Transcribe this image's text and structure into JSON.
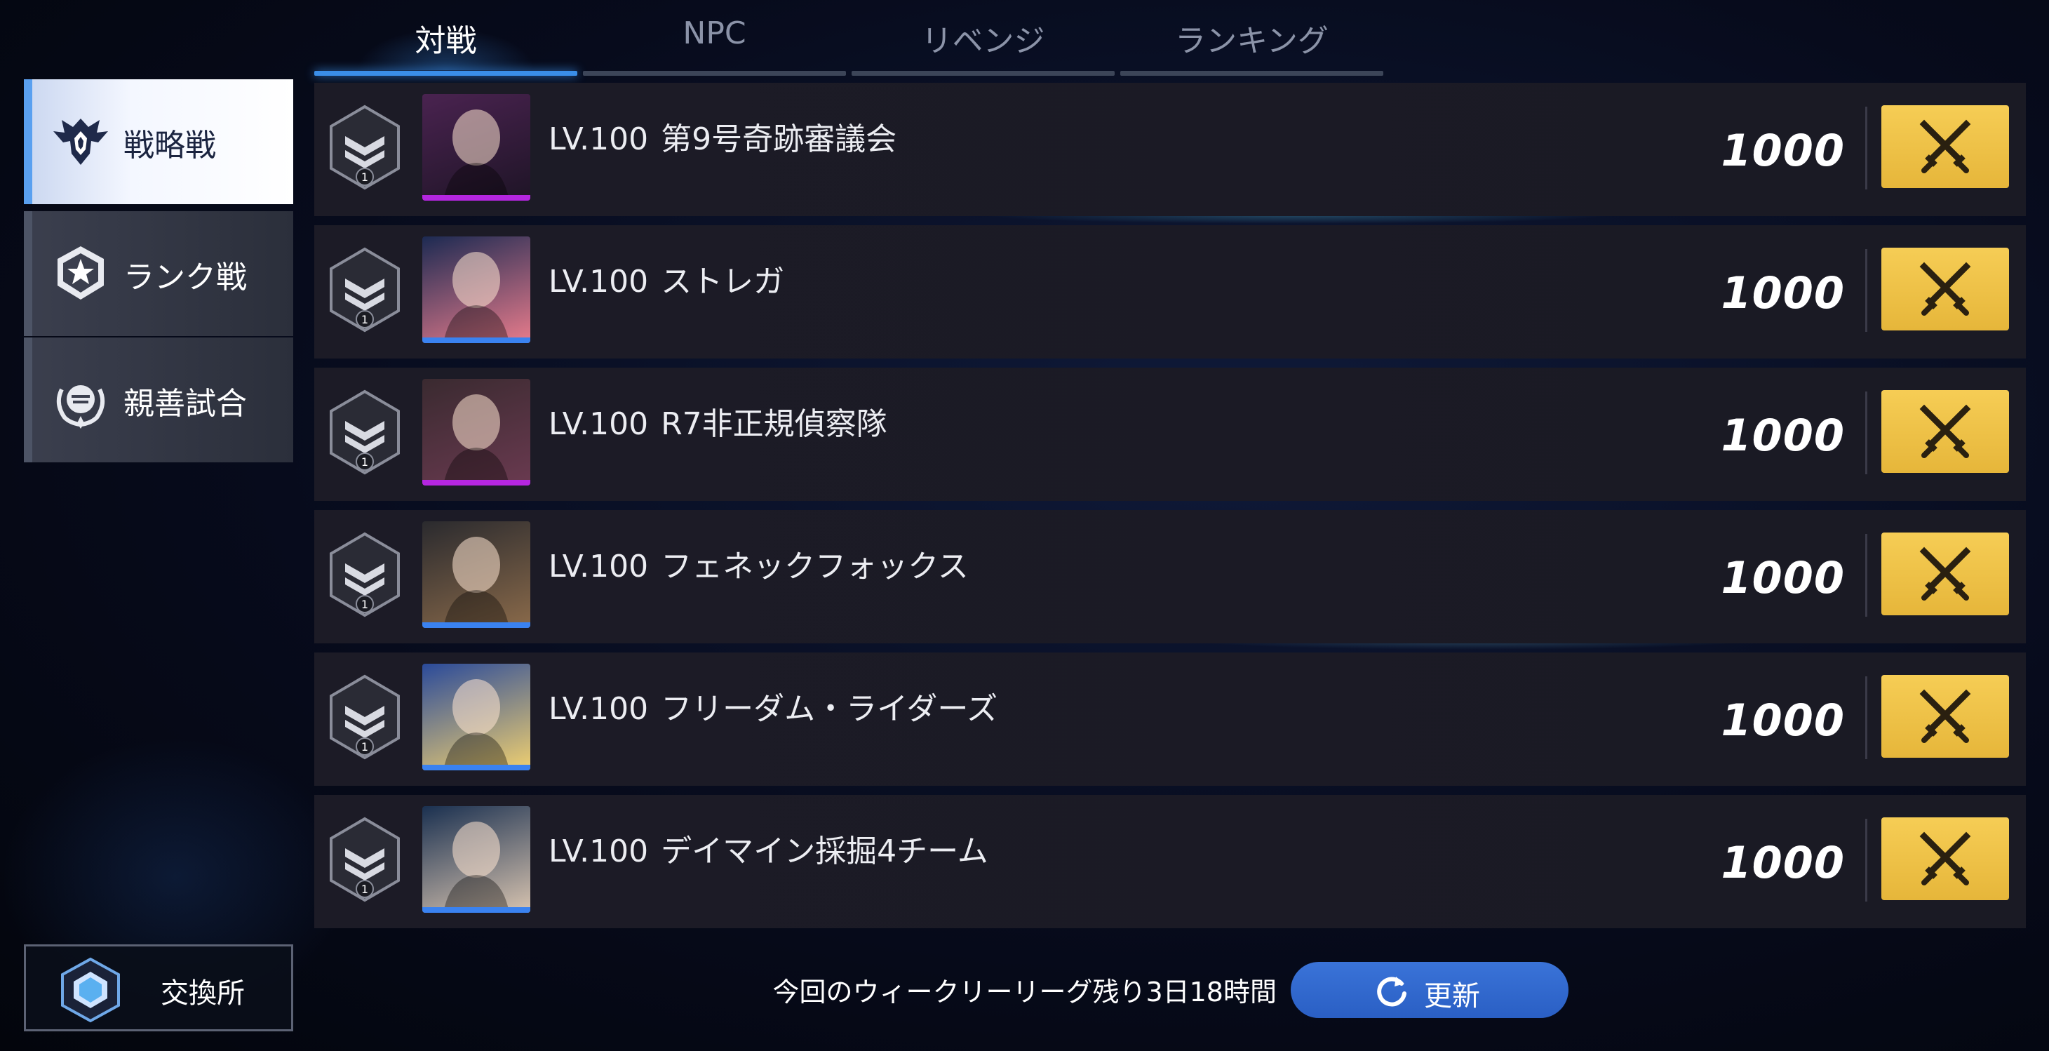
{
  "tabs": [
    {
      "label": "対戦",
      "active": true
    },
    {
      "label": "NPC",
      "active": false
    },
    {
      "label": "リベンジ",
      "active": false
    },
    {
      "label": "ランキング",
      "active": false
    }
  ],
  "side_menu": [
    {
      "label": "戦略戦",
      "icon": "eagle-emblem-icon",
      "active": true
    },
    {
      "label": "ランク戦",
      "icon": "star-emblem-icon",
      "active": false
    },
    {
      "label": "親善試合",
      "icon": "laurel-fist-icon",
      "active": false
    }
  ],
  "opponents": [
    {
      "level": "LV.100",
      "name": "第9号奇跡審議会",
      "score": "1000",
      "rank": "1",
      "portrait_bar_color": "#b526e0",
      "portrait_bg": [
        "#4a2350",
        "#1e1426"
      ]
    },
    {
      "level": "LV.100",
      "name": "ストレガ",
      "score": "1000",
      "rank": "1",
      "portrait_bar_color": "#3a82f0",
      "portrait_bg": [
        "#1c2a52",
        "#e87c8c"
      ]
    },
    {
      "level": "LV.100",
      "name": "R7非正規偵察隊",
      "score": "1000",
      "rank": "1",
      "portrait_bar_color": "#b526e0",
      "portrait_bg": [
        "#3a2a30",
        "#6a3a50"
      ]
    },
    {
      "level": "LV.100",
      "name": "フェネックフォックス",
      "score": "1000",
      "rank": "1",
      "portrait_bar_color": "#3a82f0",
      "portrait_bg": [
        "#2a2a2e",
        "#8a6a4a"
      ]
    },
    {
      "level": "LV.100",
      "name": "フリーダム・ライダーズ",
      "score": "1000",
      "rank": "1",
      "portrait_bar_color": "#3a82f0",
      "portrait_bg": [
        "#2a4a9a",
        "#f0d070"
      ]
    },
    {
      "level": "LV.100",
      "name": "デイマイン採掘4チーム",
      "score": "1000",
      "rank": "1",
      "portrait_bar_color": "#3a82f0",
      "portrait_bg": [
        "#1a3050",
        "#d8c4b0"
      ]
    }
  ],
  "exchange": {
    "label": "交換所",
    "icon": "hexagon-gem-icon"
  },
  "weekly_status": "今回のウィークリーリーグ残り3日18時間",
  "refresh": {
    "label": "更新",
    "icon": "refresh-icon"
  },
  "colors": {
    "accent_blue": "#3a8ee8",
    "fight_gold": "#f2c64a",
    "row_bg": "#1c1b26"
  }
}
